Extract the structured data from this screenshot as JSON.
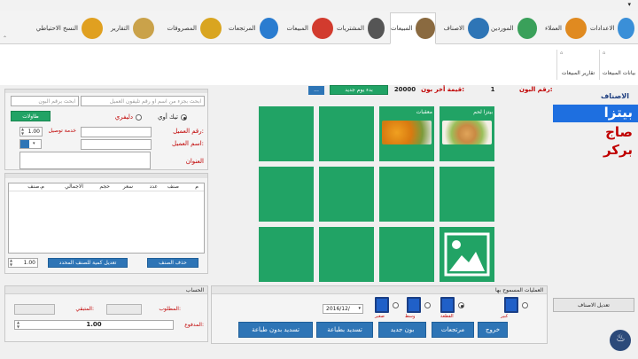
{
  "window": {
    "menu_glyph": "▾"
  },
  "tabs": [
    {
      "label": "الاعدادات",
      "icon": "settings-icon"
    },
    {
      "label": "العملاء",
      "icon": "customers-icon"
    },
    {
      "label": "الموردين",
      "icon": "suppliers-icon"
    },
    {
      "label": "الاصناف",
      "icon": "items-icon"
    },
    {
      "label": "المبيعات",
      "icon": "sales-icon",
      "active": true
    },
    {
      "label": "المشتريات",
      "icon": "purchases-icon"
    },
    {
      "label": "المبيعات",
      "icon": "sale-tag-icon"
    },
    {
      "label": "المرتجعات",
      "icon": "returns-icon"
    },
    {
      "label": "المصروفات",
      "icon": "expenses-icon"
    },
    {
      "label": "التقارير",
      "icon": "reports-icon"
    },
    {
      "label": "النسخ الاحتياطي",
      "icon": "backup-icon"
    }
  ],
  "subbar": {
    "data_label": "بيانات المبيعات",
    "reports_label": "تقارير المبيعات"
  },
  "invoice_bar": {
    "invoice_no_label": "رقم البون:",
    "invoice_no": "1",
    "last_value_label": "قيمة أخر بون:",
    "last_value": "20000",
    "new_day_button": "بدء يوم جديد",
    "dots_button": "..."
  },
  "customer": {
    "search_placeholder": "ابحث بجزء من اسم او رقم تليفون العميل",
    "barcode_placeholder": "ابحث برقم البون",
    "tables_button": "طاولات",
    "takeaway_label": "تيك أوي",
    "delivery_label": "دليفري",
    "phone_label": "رقم العميل:",
    "name_label": "اسم العميل:",
    "address_label": "العنوان",
    "delivery_fee_label": "خدمة توصيل",
    "delivery_fee": "1.00"
  },
  "order_table": {
    "columns": [
      "م",
      "صنف",
      "عدد",
      "سعر",
      "حجم",
      "الاجمالي",
      "م.صنف"
    ]
  },
  "order_actions": {
    "delete_button": "حذف الصنف",
    "edit_qty_button": "تعديل كمية للصنف المحدد",
    "qty_value": "1.00"
  },
  "totals": {
    "header": "الحساب",
    "required_label": "المطلوب:",
    "remaining_label": "المتبقي:",
    "paid_label": "المدفوع:",
    "paid_value": "1.00"
  },
  "categories_panel": {
    "title": "الاصناف",
    "items": [
      "بيتزا",
      "صاج",
      "بركر"
    ],
    "selected": 0,
    "edit_button": "تعديل الاصناف"
  },
  "product_tiles": [
    {
      "label": "بيتزا لحم",
      "has_image": true
    },
    {
      "label": "معقبات",
      "has_image": true
    }
  ],
  "operations": {
    "header": "العمليات المسموح بها",
    "sizes": [
      "كبير",
      "القطعة",
      "وسط",
      "صغير"
    ],
    "date_value": "2016/12/",
    "buttons": [
      "خروج",
      "مرتجعات",
      "بون جديد",
      "تسديد بطباعة",
      "تسديد بدون طباعة"
    ]
  },
  "colors": {
    "accent_green": "#21a365",
    "accent_blue": "#2e75b6",
    "label_red": "#c00000"
  }
}
